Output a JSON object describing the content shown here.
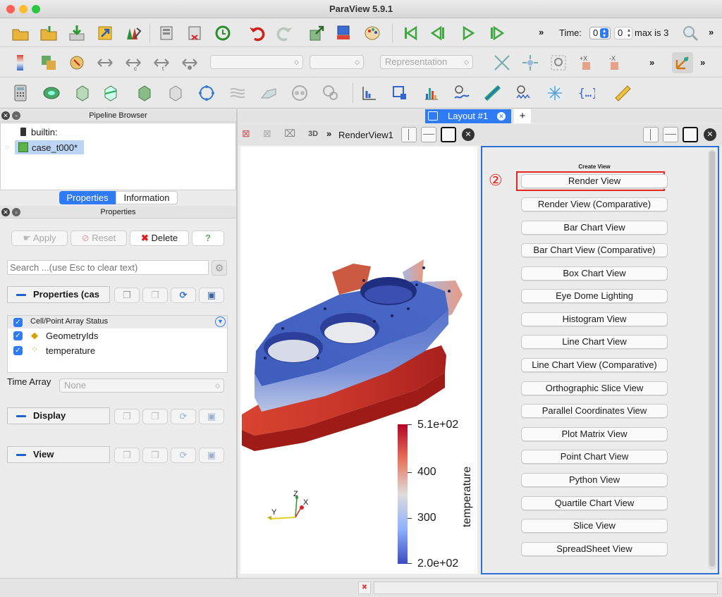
{
  "window": {
    "title": "ParaView 5.9.1"
  },
  "time_toolbar": {
    "time_label": "Time:",
    "time_value": "0",
    "index_value": "0",
    "max_label": "max is 3"
  },
  "toolbar2": {
    "representation_placeholder": "Representation"
  },
  "pipeline": {
    "header": "Pipeline Browser",
    "items": [
      {
        "label": "builtin:"
      },
      {
        "label": "case_t000*"
      }
    ]
  },
  "tabs": {
    "properties": "Properties",
    "information": "Information"
  },
  "properties_panel": {
    "header": "Properties",
    "apply_label": "Apply",
    "reset_label": "Reset",
    "delete_label": "Delete",
    "help_label": "?",
    "search_placeholder": "Search ...(use Esc to clear text)",
    "section_properties": "Properties (cas",
    "array_status_header": "Cell/Point Array Status",
    "arrays": [
      {
        "label": "GeometryIds"
      },
      {
        "label": "temperature"
      }
    ],
    "time_array_label": "Time Array",
    "time_array_value": "None",
    "section_display": "Display",
    "section_view": "View"
  },
  "layout": {
    "tab_label": "Layout #1",
    "add_tab": "+"
  },
  "render_view": {
    "mode_label": "3D",
    "name": "RenderView1"
  },
  "colorbar": {
    "title": "temperature",
    "labels": [
      "5.1e+02",
      "400",
      "300",
      "2.0e+02"
    ],
    "color_min": "#3b4cc0",
    "color_max": "#b40426"
  },
  "axes": {
    "z": "Z",
    "y": "Y",
    "x": "X"
  },
  "create_view": {
    "header": "Create View",
    "marker": "②",
    "highlight_color": "#e8261f",
    "buttons": [
      "Render View",
      "Render View (Comparative)",
      "Bar Chart View",
      "Bar Chart View (Comparative)",
      "Box Chart View",
      "Eye Dome Lighting",
      "Histogram View",
      "Line Chart View",
      "Line Chart View (Comparative)",
      "Orthographic Slice View",
      "Parallel Coordinates View",
      "Plot Matrix View",
      "Point Chart View",
      "Python View",
      "Quartile Chart View",
      "Slice View",
      "SpreadSheet View"
    ]
  }
}
